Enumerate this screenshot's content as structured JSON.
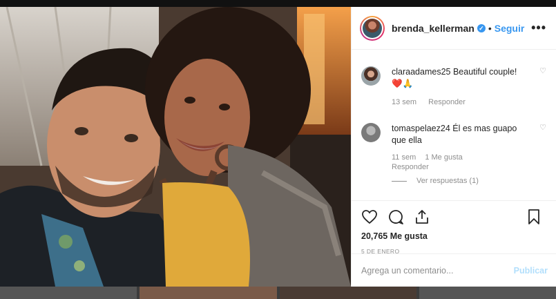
{
  "post": {
    "owner": "brenda_kellerman",
    "verified_icon": "verified-badge-icon",
    "separator": "•",
    "follow_label": "Seguir",
    "more_icon": "more-options-icon",
    "more_glyph": "•••"
  },
  "comments": [
    {
      "user": "claraadames25",
      "text": "Beautiful couple!",
      "emoji": "❤️🙏",
      "time": "13 sem",
      "reply_label": "Responder",
      "likes": ""
    },
    {
      "user": "tomaspelaez24",
      "text": "Él es mas guapo que ella",
      "time": "11 sem",
      "likes": "1 Me gusta",
      "reply_label": "Responder",
      "view_replies": "Ver respuestas (1)"
    }
  ],
  "actions": {
    "like_count": "20,765 Me gusta",
    "date": "5 DE ENERO"
  },
  "composer": {
    "placeholder": "Agrega un comentario...",
    "publish_label": "Publicar"
  },
  "colors": {
    "accent": "#3897f0",
    "publish_disabled": "#b2dffc",
    "muted": "#8e8e8e",
    "text": "#262626"
  }
}
